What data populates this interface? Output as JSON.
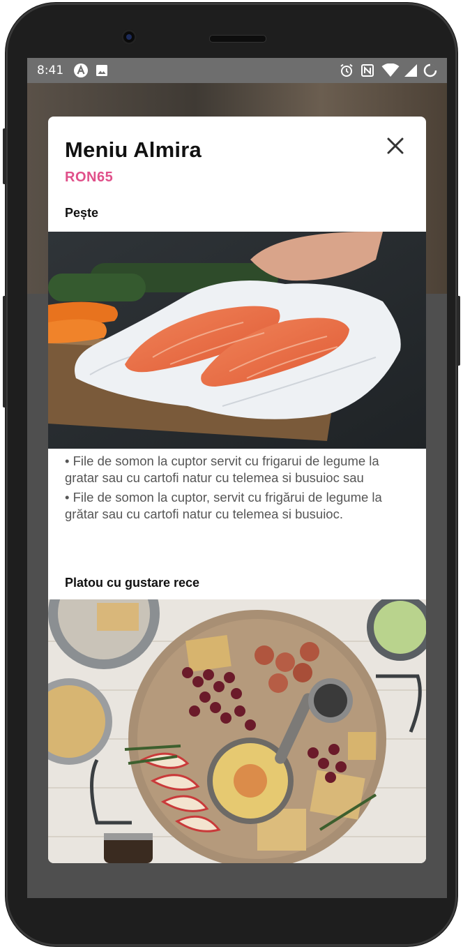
{
  "status_bar": {
    "time": "8:41",
    "left_icons": [
      "app-notification-icon",
      "image-notification-icon"
    ],
    "right_icons": [
      "alarm-icon",
      "nfc-icon",
      "wifi-icon",
      "signal-icon",
      "battery-icon"
    ]
  },
  "modal": {
    "title": "Meniu Almira",
    "price": "RON65",
    "sections": [
      {
        "title": "Pește",
        "image": "salmon-fillet-image",
        "items": [
          "• File de somon la cuptor servit cu frigarui de legume la gratar sau cu cartofi natur cu telemea si busuioc sau",
          "• File de somon la cuptor, servit cu frigărui de legume la grătar sau cu cartofi natur cu telemea si busuioc."
        ]
      },
      {
        "title": "Platou cu gustare rece",
        "image": "cold-platter-image"
      }
    ]
  },
  "colors": {
    "price_accent": "#e0508a",
    "overlay": "#555555"
  }
}
